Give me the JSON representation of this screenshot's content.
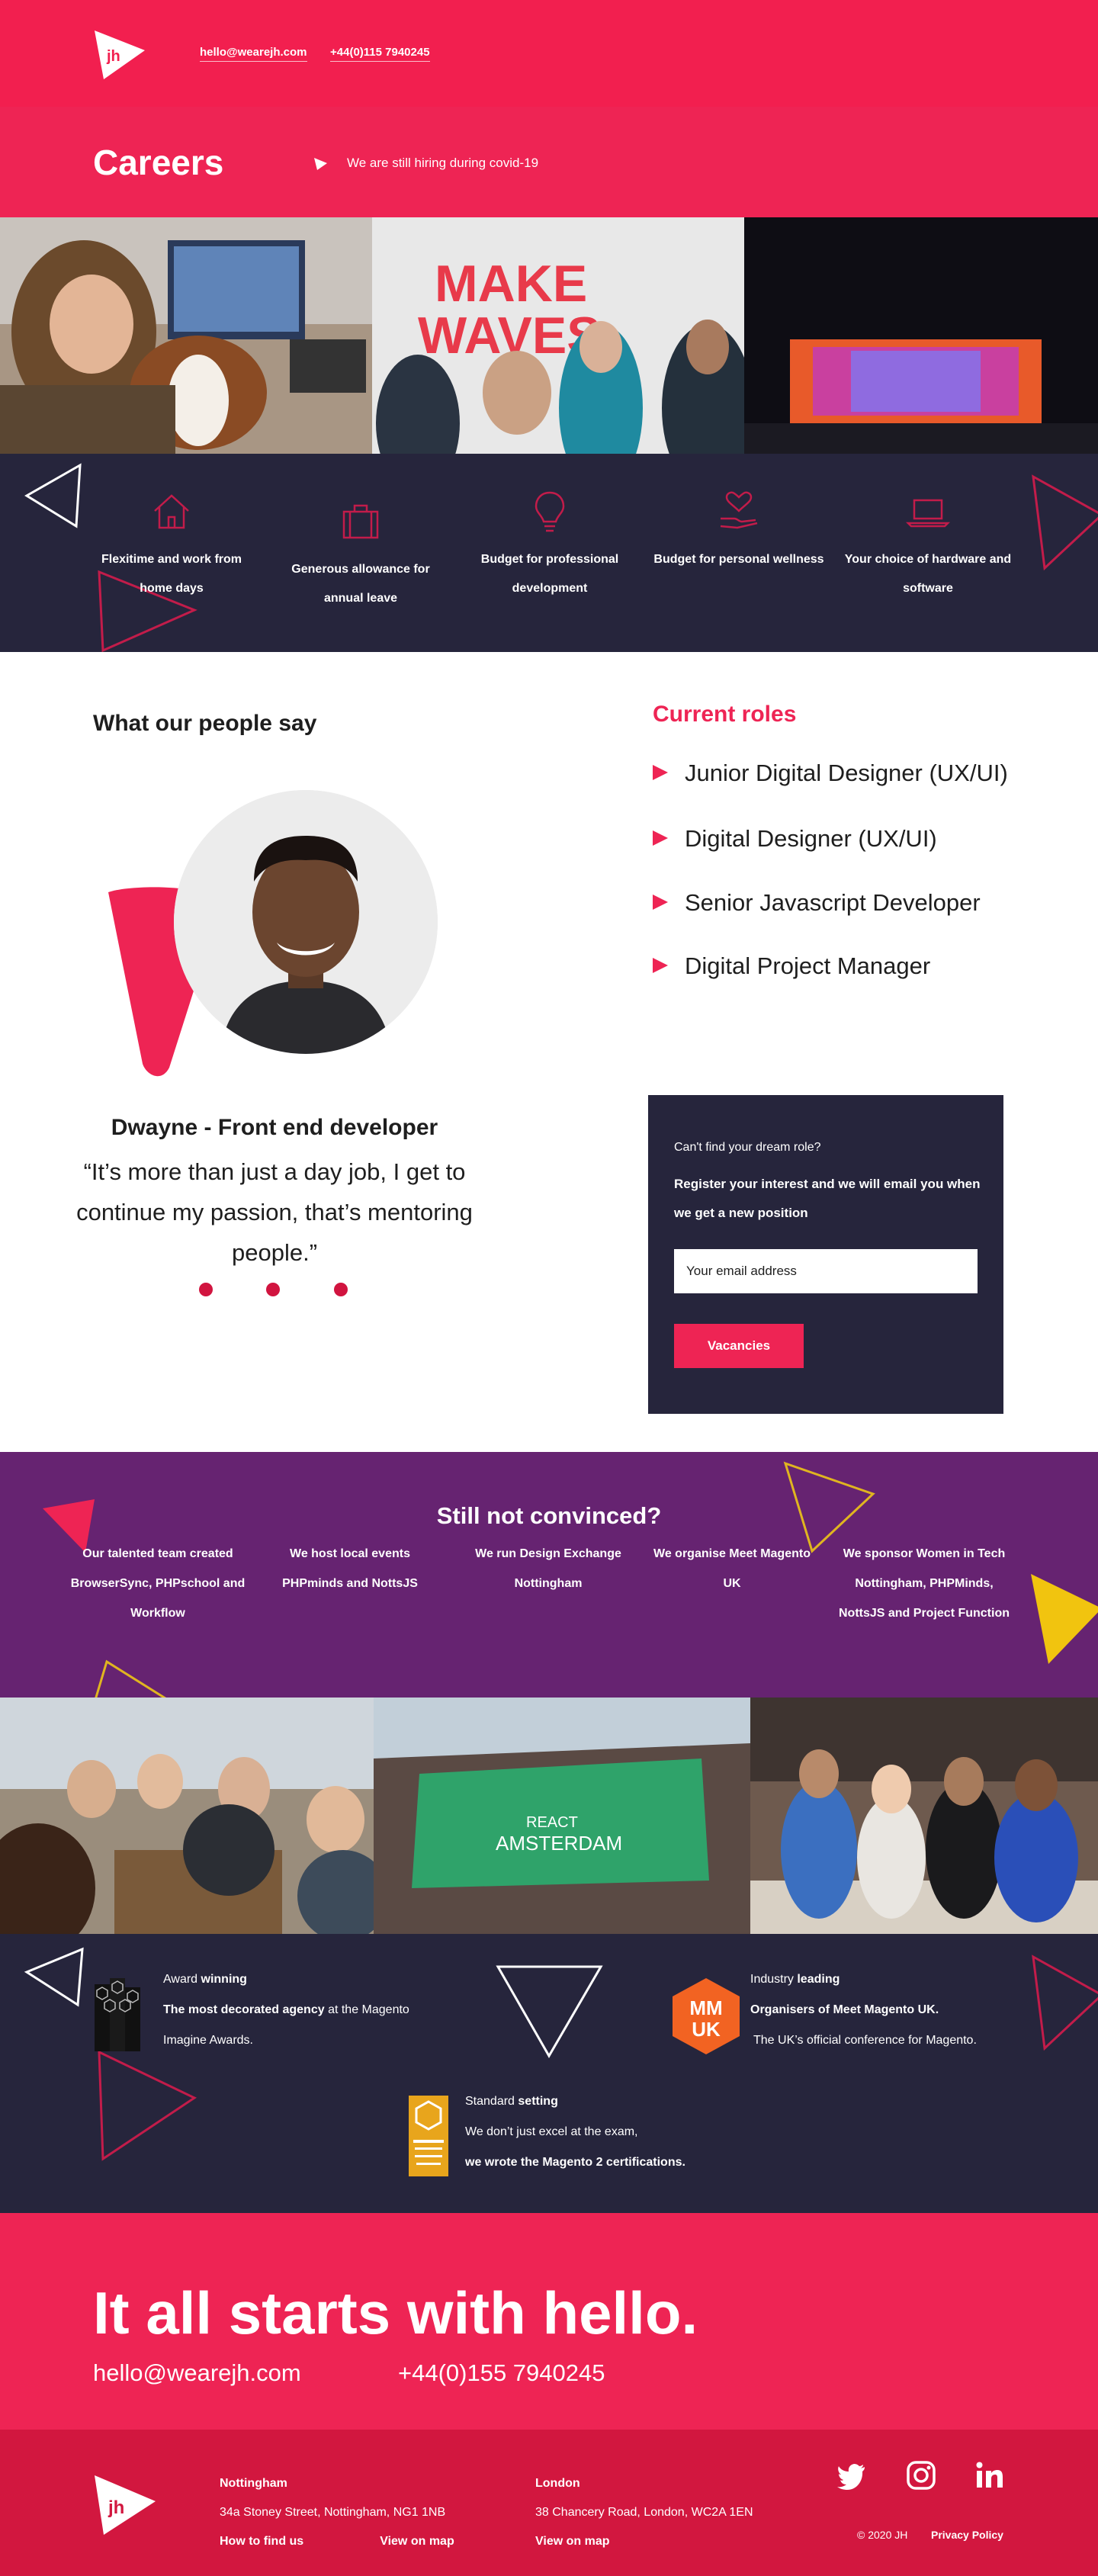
{
  "header": {
    "email": "hello@wearejh.com",
    "phone": "+44(0)115 7940245",
    "logo_text": "jh"
  },
  "careers": {
    "title": "Careers",
    "note": "We are still hiring during covid-19"
  },
  "hero_photos": {
    "photo2_text_line1": "MAKE",
    "photo2_text_line2": "WAVES"
  },
  "benefits": [
    {
      "icon": "house-icon",
      "label": "Flexitime and work from home days"
    },
    {
      "icon": "suitcase-icon",
      "label": "Generous allowance for annual leave"
    },
    {
      "icon": "lightbulb-icon",
      "label": "Budget for professional development"
    },
    {
      "icon": "heart-hand-icon",
      "label": "Budget for personal wellness"
    },
    {
      "icon": "laptop-icon",
      "label": "Your choice of hardware and software"
    }
  ],
  "testimonial": {
    "section_title": "What our people say",
    "name": "Dwayne - Front end developer",
    "quote": "“It’s more than just a day job, I get to continue my passion, that’s mentoring people.”"
  },
  "roles": {
    "title": "Current roles",
    "items": [
      "Junior Digital Designer (UX/UI)",
      "Digital Designer (UX/UI)",
      "Senior Javascript Developer",
      "Digital Project Manager"
    ]
  },
  "cta": {
    "question": "Can't find your dream role?",
    "text": "Register your interest and we will email you when we get a new position",
    "email_placeholder": "Your email address",
    "button": "Vacancies"
  },
  "convinced": {
    "title": "Still not convinced?",
    "facts": [
      "Our talented team created BrowserSync, PHPschool and Workflow",
      "We host local events PHPminds and NottsJS",
      "We run Design Exchange Nottingham",
      "We organise Meet Magento UK",
      "We sponsor Women in Tech Nottingham, PHPMinds, NottsJS and Project Function"
    ]
  },
  "photos2": {
    "react_line1": "REACT",
    "react_line2": "AMSTERDAM"
  },
  "awards": {
    "a1": {
      "pre": "Award ",
      "pre_bold": "winning",
      "bold": "The most decorated agency",
      "rest": " at the Magento",
      "line3": "Imagine Awards."
    },
    "a2": {
      "pre": "Industry ",
      "pre_bold": "leading",
      "bold": "Organisers of Meet Magento UK.",
      "line3": "The UK’s official conference for Magento.",
      "badge_top": "MM",
      "badge_bottom": "UK"
    },
    "a3": {
      "pre": "Standard ",
      "pre_bold": "setting",
      "line2": "We don’t just excel at the exam,",
      "bold": "we wrote the Magento 2 certifications."
    }
  },
  "hello": {
    "title": "It all starts with hello.",
    "email": "hello@wearejh.com",
    "phone": "+44(0)155 7940245"
  },
  "footer": {
    "nottingham": {
      "title": "Nottingham",
      "address": "34a Stoney Street, Nottingham, NG1 1NB",
      "find": "How to find us",
      "map": "View on map"
    },
    "london": {
      "title": "London",
      "address": "38 Chancery Road, London, WC2A 1EN",
      "map": "View on map"
    },
    "copyright": "© 2020 JH",
    "privacy": "Privacy Policy",
    "logo_text": "jh"
  },
  "colors": {
    "brand_red": "#ee2454",
    "navy": "#26253c",
    "purple": "#662371",
    "yellow": "#f1c40f"
  }
}
